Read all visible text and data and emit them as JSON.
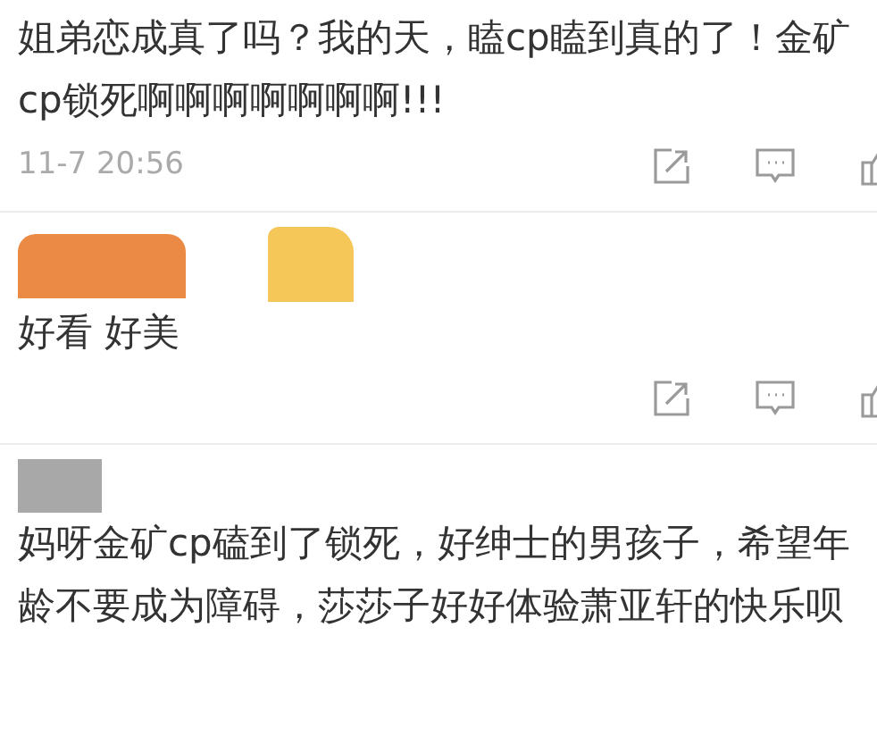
{
  "comments": [
    {
      "kind": "full",
      "text": "姐弟恋成真了吗？我的天，瞌cp瞌到真的了！金矿cp锁死啊啊啊啊啊啊啊!!!",
      "time": "11-7 20:56"
    },
    {
      "kind": "full",
      "text": "好看 好美",
      "redactions": [
        {
          "color": "#eb8a45"
        },
        {
          "color": "#f5c758"
        }
      ]
    },
    {
      "kind": "text_only",
      "text": "妈呀金矿cp磕到了锁死，好绅士的男孩子，希望年龄不要成为障碍，莎莎子好好体验萧亚轩的快乐呗",
      "redactions": [
        {
          "color": "#a8a8a8"
        }
      ]
    }
  ]
}
